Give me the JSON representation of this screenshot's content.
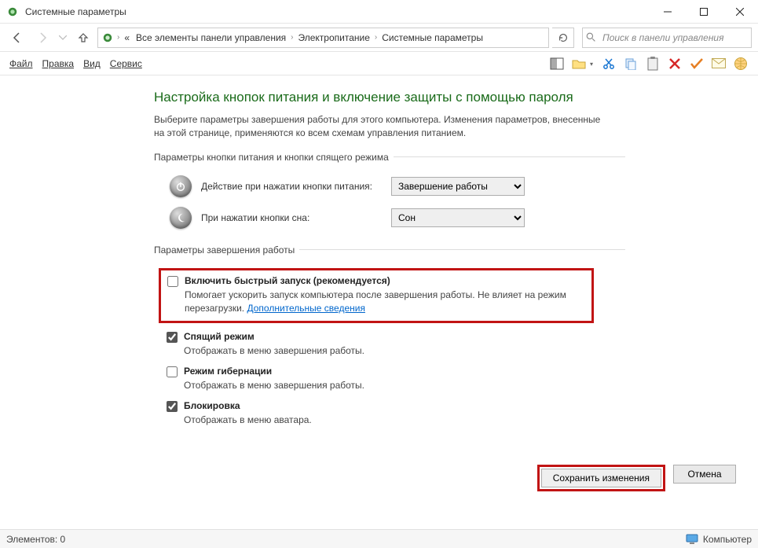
{
  "window": {
    "title": "Системные параметры"
  },
  "breadcrumb": {
    "prefix": "«",
    "seg1": "Все элементы панели управления",
    "seg2": "Электропитание",
    "seg3": "Системные параметры"
  },
  "search": {
    "placeholder": "Поиск в панели управления"
  },
  "menu": {
    "file": "Файл",
    "edit": "Правка",
    "view": "Вид",
    "service": "Сервис"
  },
  "page": {
    "title": "Настройка кнопок питания и включение защиты с помощью пароля",
    "description": "Выберите параметры завершения работы для этого компьютера. Изменения параметров, внесенные на этой странице, применяются ко всем схемам управления питанием."
  },
  "group_power": {
    "legend": "Параметры кнопки питания и кнопки спящего режима",
    "row1_label": "Действие при нажатии кнопки питания:",
    "row1_value": "Завершение работы",
    "row2_label": "При нажатии кнопки сна:",
    "row2_value": "Сон"
  },
  "group_shutdown": {
    "legend": "Параметры завершения работы",
    "opt1": {
      "title": "Включить быстрый запуск (рекомендуется)",
      "sub": "Помогает ускорить запуск компьютера после завершения работы. Не влияет на режим перезагрузки.",
      "link": "Дополнительные сведения",
      "checked": false
    },
    "opt2": {
      "title": "Спящий режим",
      "sub": "Отображать в меню завершения работы.",
      "checked": true
    },
    "opt3": {
      "title": "Режим гибернации",
      "sub": "Отображать в меню завершения работы.",
      "checked": false
    },
    "opt4": {
      "title": "Блокировка",
      "sub": "Отображать в меню аватара.",
      "checked": true
    }
  },
  "buttons": {
    "save": "Сохранить изменения",
    "cancel": "Отмена"
  },
  "status": {
    "left": "Элементов: 0",
    "right": "Компьютер"
  }
}
